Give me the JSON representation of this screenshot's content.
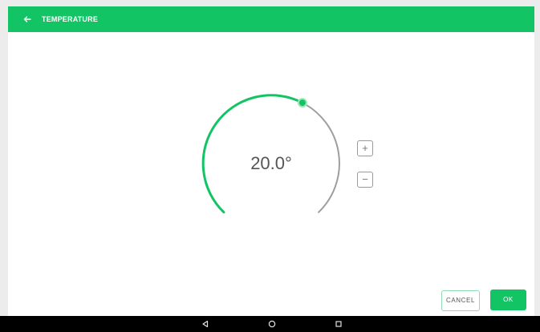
{
  "app_bar": {
    "title": "TEMPERATURE",
    "back_icon": "arrow-left-icon",
    "color": "#13c465"
  },
  "dial": {
    "value_label": "20.0°",
    "value": 20.0,
    "active_color": "#13c465",
    "track_color": "#9e9e9e"
  },
  "stepper": {
    "plus_label": "+",
    "minus_label": "−"
  },
  "actions": {
    "cancel_label": "CANCEL",
    "ok_label": "OK"
  },
  "system_nav": {
    "back_icon": "triangle-back-icon",
    "home_icon": "circle-home-icon",
    "recents_icon": "square-recents-icon"
  }
}
